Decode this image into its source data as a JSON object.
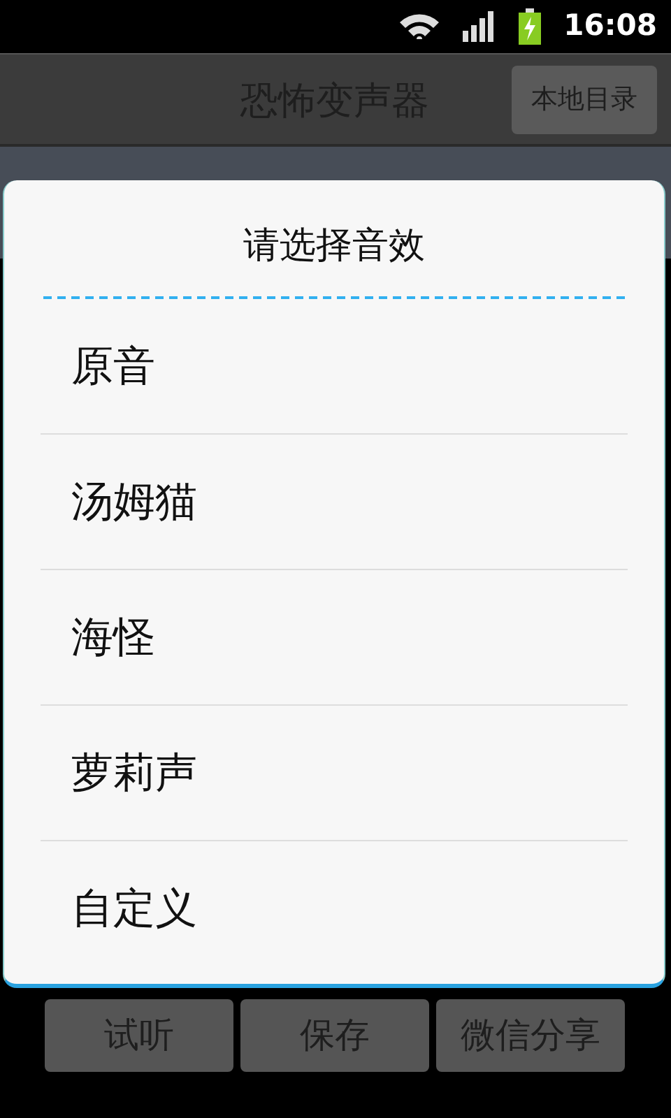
{
  "status_bar": {
    "time": "16:08"
  },
  "app_bar": {
    "title": "恐怖变声器",
    "button": "本地目录"
  },
  "dialog": {
    "title": "请选择音效",
    "items": [
      {
        "label": "原音"
      },
      {
        "label": "汤姆猫"
      },
      {
        "label": "海怪"
      },
      {
        "label": "萝莉声"
      },
      {
        "label": "自定义"
      }
    ]
  },
  "buttons": [
    "试听",
    "保存",
    "微信分享"
  ]
}
